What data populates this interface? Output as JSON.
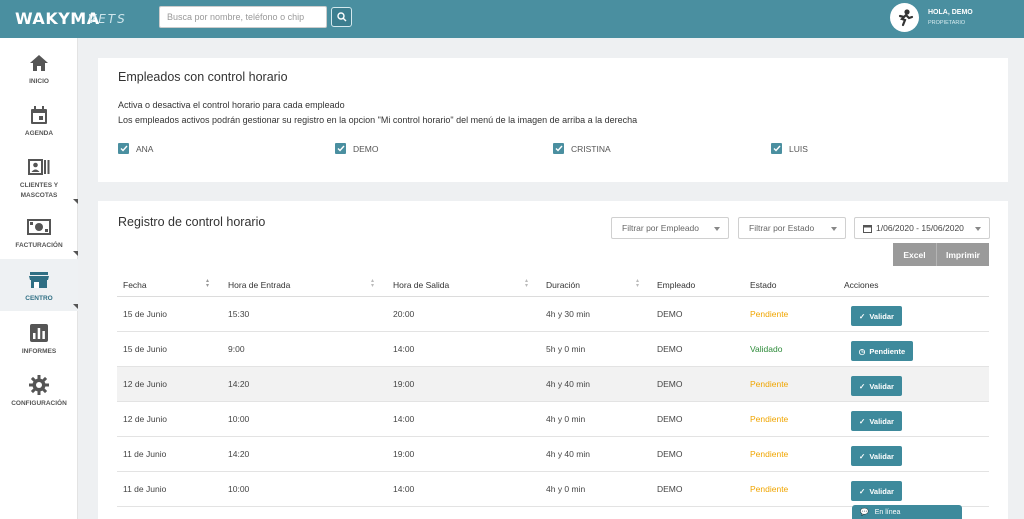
{
  "brand": {
    "logo": "WAKYMA",
    "sub": "VETS"
  },
  "search": {
    "placeholder": "Busca por nombre, teléfono o chip"
  },
  "user": {
    "greeting": "HOLA, DEMO",
    "role": "PROPIETARIO"
  },
  "sidebar": {
    "items": [
      {
        "label": "INICIO",
        "icon": "home-icon"
      },
      {
        "label": "AGENDA",
        "icon": "calendar-icon"
      },
      {
        "label": "CLIENTES Y MASCOTAS",
        "icon": "clients-icon"
      },
      {
        "label": "FACTURACIÓN",
        "icon": "billing-icon"
      },
      {
        "label": "CENTRO",
        "icon": "store-icon"
      },
      {
        "label": "INFORMES",
        "icon": "chart-icon"
      },
      {
        "label": "CONFIGURACIÓN",
        "icon": "gear-icon"
      }
    ]
  },
  "employees_panel": {
    "title": "Empleados con control horario",
    "line1": "Activa o desactiva el control horario para cada empleado",
    "line2": "Los empleados activos podrán gestionar su registro en la opcion \"Mi control horario\" del menú de la imagen de arriba a la derecha",
    "employees": [
      "ANA",
      "DEMO",
      "CRISTINA",
      "LUIS"
    ]
  },
  "log_panel": {
    "title": "Registro de control horario",
    "filter_employee": "Filtrar por Empleado",
    "filter_status": "Filtrar por Estado",
    "date_range": "1/06/2020 - 15/06/2020",
    "excel": "Excel",
    "print": "Imprimir",
    "headers": [
      "Fecha",
      "Hora de Entrada",
      "Hora de Salida",
      "Duración",
      "Empleado",
      "Estado",
      "Acciones"
    ],
    "rows": [
      {
        "fecha": "15 de Junio",
        "entrada": "15:30",
        "salida": "20:00",
        "duracion": "4h y 30 min",
        "empleado": "DEMO",
        "estado": "Pendiente",
        "accion": "Validar"
      },
      {
        "fecha": "15 de Junio",
        "entrada": "9:00",
        "salida": "14:00",
        "duracion": "5h y 0 min",
        "empleado": "DEMO",
        "estado": "Validado",
        "accion": "Pendiente"
      },
      {
        "fecha": "12 de Junio",
        "entrada": "14:20",
        "salida": "19:00",
        "duracion": "4h y 40 min",
        "empleado": "DEMO",
        "estado": "Pendiente",
        "accion": "Validar"
      },
      {
        "fecha": "12 de Junio",
        "entrada": "10:00",
        "salida": "14:00",
        "duracion": "4h y 0 min",
        "empleado": "DEMO",
        "estado": "Pendiente",
        "accion": "Validar"
      },
      {
        "fecha": "11 de Junio",
        "entrada": "14:20",
        "salida": "19:00",
        "duracion": "4h y 40 min",
        "empleado": "DEMO",
        "estado": "Pendiente",
        "accion": "Validar"
      },
      {
        "fecha": "11 de Junio",
        "entrada": "10:00",
        "salida": "14:00",
        "duracion": "4h y 0 min",
        "empleado": "DEMO",
        "estado": "Pendiente",
        "accion": "Validar"
      }
    ]
  },
  "chat": {
    "label": "En línea"
  },
  "colors": {
    "primary": "#4a8fa0",
    "button": "#3e8a9c",
    "pending": "#f0a500",
    "validated": "#2e8b3a"
  }
}
